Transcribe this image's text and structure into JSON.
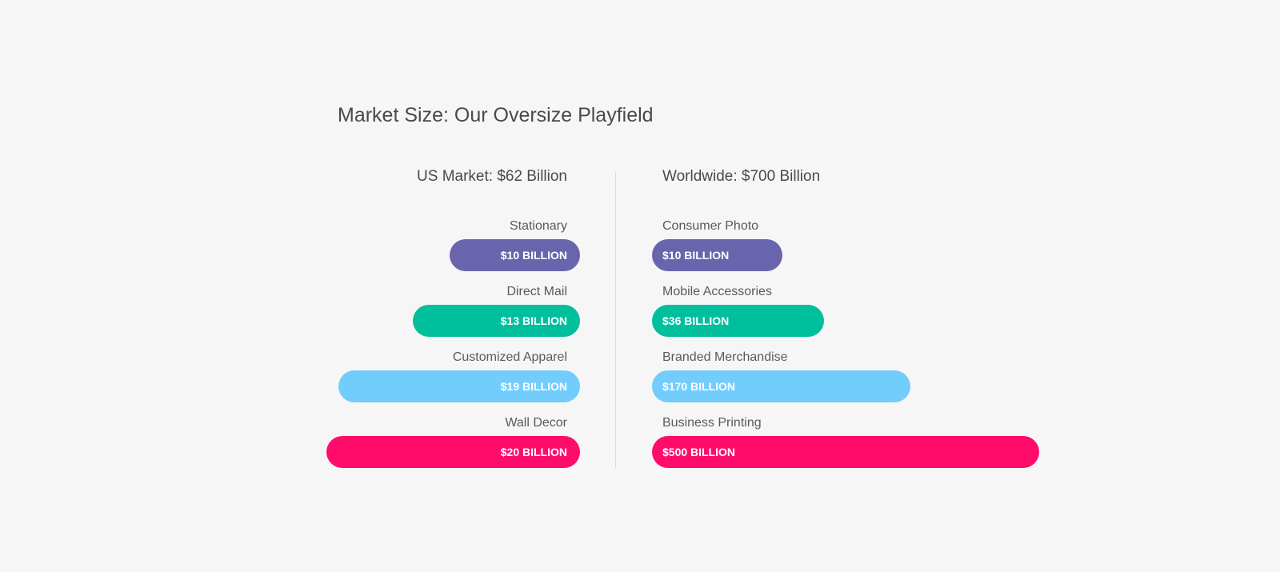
{
  "title": "Market Size: Our Oversize Playfield",
  "chart_data": [
    {
      "type": "bar",
      "orientation": "horizontal",
      "direction": "right-to-left",
      "title": "US Market: $62 Billion",
      "categories": [
        "Stationary",
        "Direct Mail",
        "Customized Apparel",
        "Wall Decor"
      ],
      "values": [
        10,
        13,
        19,
        20
      ],
      "value_labels": [
        "$10 BILLION",
        "$13 BILLION",
        "$19 BILLION",
        "$20 BILLION"
      ],
      "colors": [
        "#6865ad",
        "#00bf9d",
        "#72cdfd",
        "#ff0c6a"
      ]
    },
    {
      "type": "bar",
      "orientation": "horizontal",
      "direction": "left-to-right",
      "title": "Worldwide: $700 Billion",
      "categories": [
        "Consumer Photo",
        "Mobile Accessories",
        "Branded Merchandise",
        "Business Printing"
      ],
      "values": [
        10,
        36,
        170,
        500
      ],
      "value_labels": [
        "$10 BILLION",
        "$36 BILLION",
        "$170 BILLION",
        "$500 BILLION"
      ],
      "colors": [
        "#6865ad",
        "#00bf9d",
        "#72cdfd",
        "#ff0c6a"
      ]
    }
  ]
}
